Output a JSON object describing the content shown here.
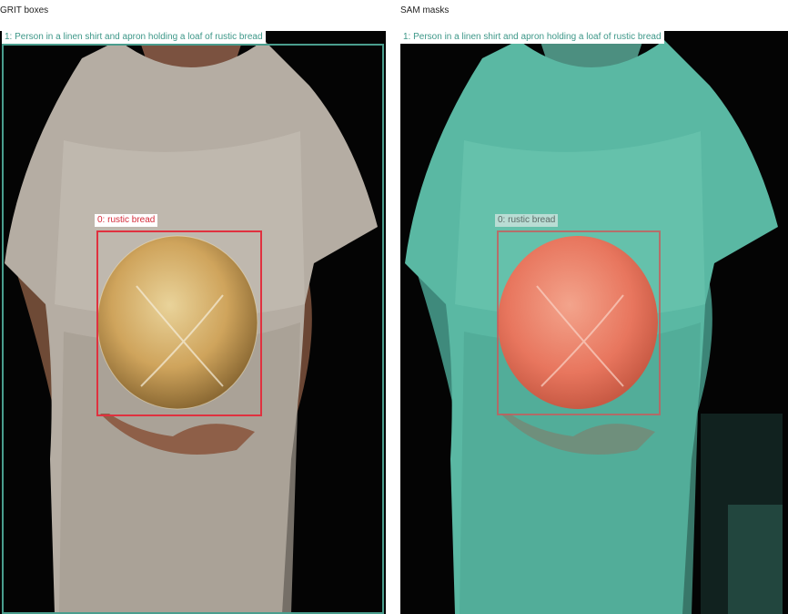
{
  "panels": {
    "left": {
      "title": "GRIT boxes",
      "person_label": "1: Person in a linen shirt and apron holding a loaf of rustic bread",
      "bread_label": "0: rustic bread"
    },
    "right": {
      "title": "SAM masks",
      "person_label": "1: Person in a linen shirt and apron holding a loaf of rustic bread",
      "bread_label": "0: rustic bread"
    }
  },
  "colors": {
    "person": "#4a9e8e",
    "bread": "#e0313f",
    "person_mask": "#5fc2ac",
    "bread_mask": "#ef6a52",
    "background": "#040404"
  }
}
